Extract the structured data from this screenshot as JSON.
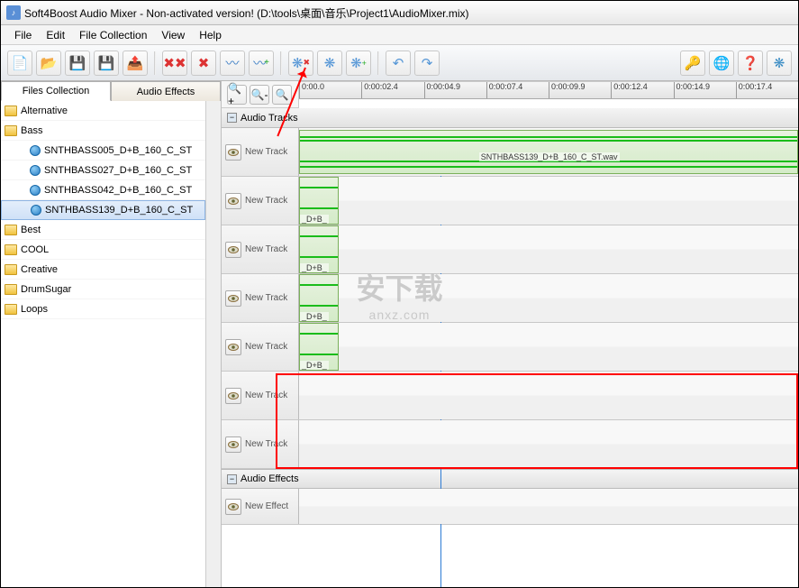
{
  "title": "Soft4Boost Audio Mixer - Non-activated version! (D:\\tools\\桌面\\音乐\\Project1\\AudioMixer.mix)",
  "menu": {
    "file": "File",
    "edit": "Edit",
    "filecoll": "File Collection",
    "view": "View",
    "help": "Help"
  },
  "tabs": {
    "files": "Files Collection",
    "effects": "Audio Effects"
  },
  "folders": {
    "alt": "Alternative",
    "bass": "Bass",
    "best": "Best",
    "cool": "COOL",
    "creative": "Creative",
    "drum": "DrumSugar",
    "loops": "Loops"
  },
  "bassfiles": [
    "SNTHBASS005_D+B_160_C_ST",
    "SNTHBASS027_D+B_160_C_ST",
    "SNTHBASS042_D+B_160_C_ST",
    "SNTHBASS139_D+B_160_C_ST"
  ],
  "ruler": [
    "0:00.0",
    "0:00:02.4",
    "0:00:04.9",
    "0:00:07.4",
    "0:00:09.9",
    "0:00:12.4",
    "0:00:14.9",
    "0:00:17.4"
  ],
  "sections": {
    "audiotracks": "Audio Tracks",
    "audioeffects": "Audio Effects"
  },
  "tracknames": [
    "New Track",
    "New Track",
    "New Track",
    "New Track",
    "New Track",
    "New Track",
    "New Track"
  ],
  "effectname": "New Effect",
  "clip1label": "SNTHBASS139_D+B_160_C_ST.wav",
  "smalllabel": "_D+B_",
  "watermark": {
    "cn": "安下载",
    "en": "anxz.com"
  }
}
